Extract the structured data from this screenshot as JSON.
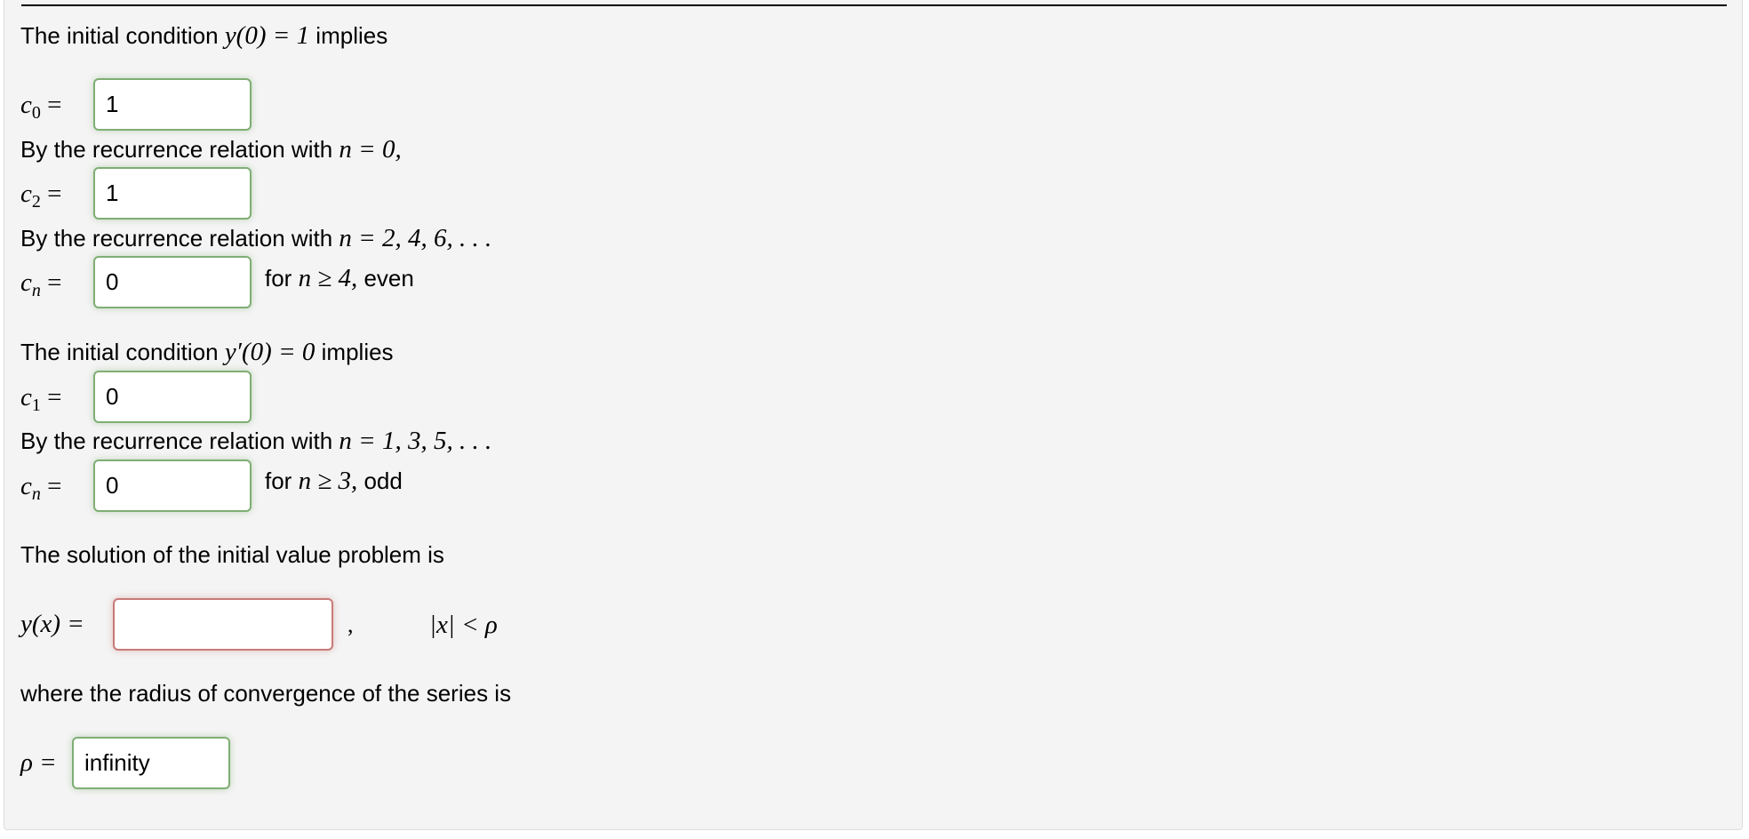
{
  "section1": {
    "intro_text": "The initial condition ",
    "intro_math": "y(0) = 1",
    "intro_suffix": " implies",
    "c0": {
      "label_var": "c",
      "label_sub": "0",
      "eq": " = ",
      "value": "1"
    },
    "rec0_text": "By the recurrence relation with ",
    "rec0_math": "n = 0,",
    "c2": {
      "label_var": "c",
      "label_sub": "2",
      "eq": " = ",
      "value": "1"
    },
    "rec_even_text": "By the recurrence relation with ",
    "rec_even_math": "n = 2, 4, 6, . . .",
    "cn_even": {
      "label_var": "c",
      "label_sub": "n",
      "eq": " = ",
      "value": "0",
      "cond_prefix": "for ",
      "cond_math": "n ≥ 4,",
      "cond_suffix": " even"
    }
  },
  "section2": {
    "intro_text": "The initial condition ",
    "intro_math": "y′(0) = 0",
    "intro_suffix": " implies",
    "c1": {
      "label_var": "c",
      "label_sub": "1",
      "eq": " = ",
      "value": "0"
    },
    "rec_odd_text": "By the recurrence relation with ",
    "rec_odd_math": "n = 1, 3, 5, . . .",
    "cn_odd": {
      "label_var": "c",
      "label_sub": "n",
      "eq": " = ",
      "value": "0",
      "cond_prefix": "for ",
      "cond_math": "n ≥ 3,",
      "cond_suffix": " odd"
    }
  },
  "solution": {
    "intro_text": "The solution of the initial value problem is",
    "label": "y(x) =",
    "value": "",
    "comma": ",",
    "domain": "|x| < ρ",
    "radius_text": "where the radius of convergence of the series is",
    "rho_label": "ρ =",
    "rho_value": "infinity"
  },
  "colors": {
    "correct_border": "#7fae74",
    "incorrect_border": "#c77a78",
    "panel_bg": "#f4f4f4"
  }
}
